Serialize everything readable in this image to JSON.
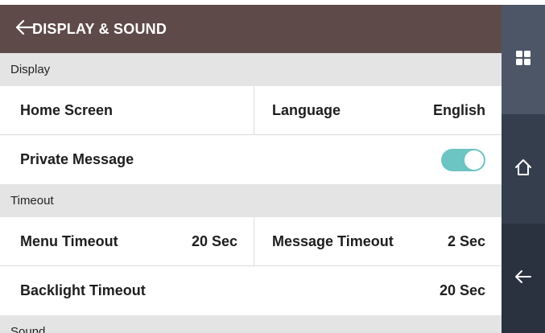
{
  "header": {
    "title": "DISPLAY & SOUND",
    "back_icon": "arrow-left-icon"
  },
  "sections": {
    "display": {
      "label": "Display",
      "home_screen": "Home Screen",
      "language_label": "Language",
      "language_value": "English",
      "private_message": "Private Message",
      "private_message_on": true
    },
    "timeout": {
      "label": "Timeout",
      "menu_timeout_label": "Menu Timeout",
      "menu_timeout_value": "20 Sec",
      "message_timeout_label": "Message Timeout",
      "message_timeout_value": "2 Sec",
      "backlight_timeout_label": "Backlight Timeout",
      "backlight_timeout_value": "20 Sec"
    },
    "sound": {
      "label": "Sound"
    }
  },
  "sidebar": {
    "icons": [
      "grid-icon",
      "home-icon",
      "back-arrow-icon"
    ]
  },
  "colors": {
    "header": "#5e4a49",
    "toggle_on": "#6cc4c3",
    "sidebar": "#2e3745",
    "section_bg": "#e4e4e4"
  }
}
